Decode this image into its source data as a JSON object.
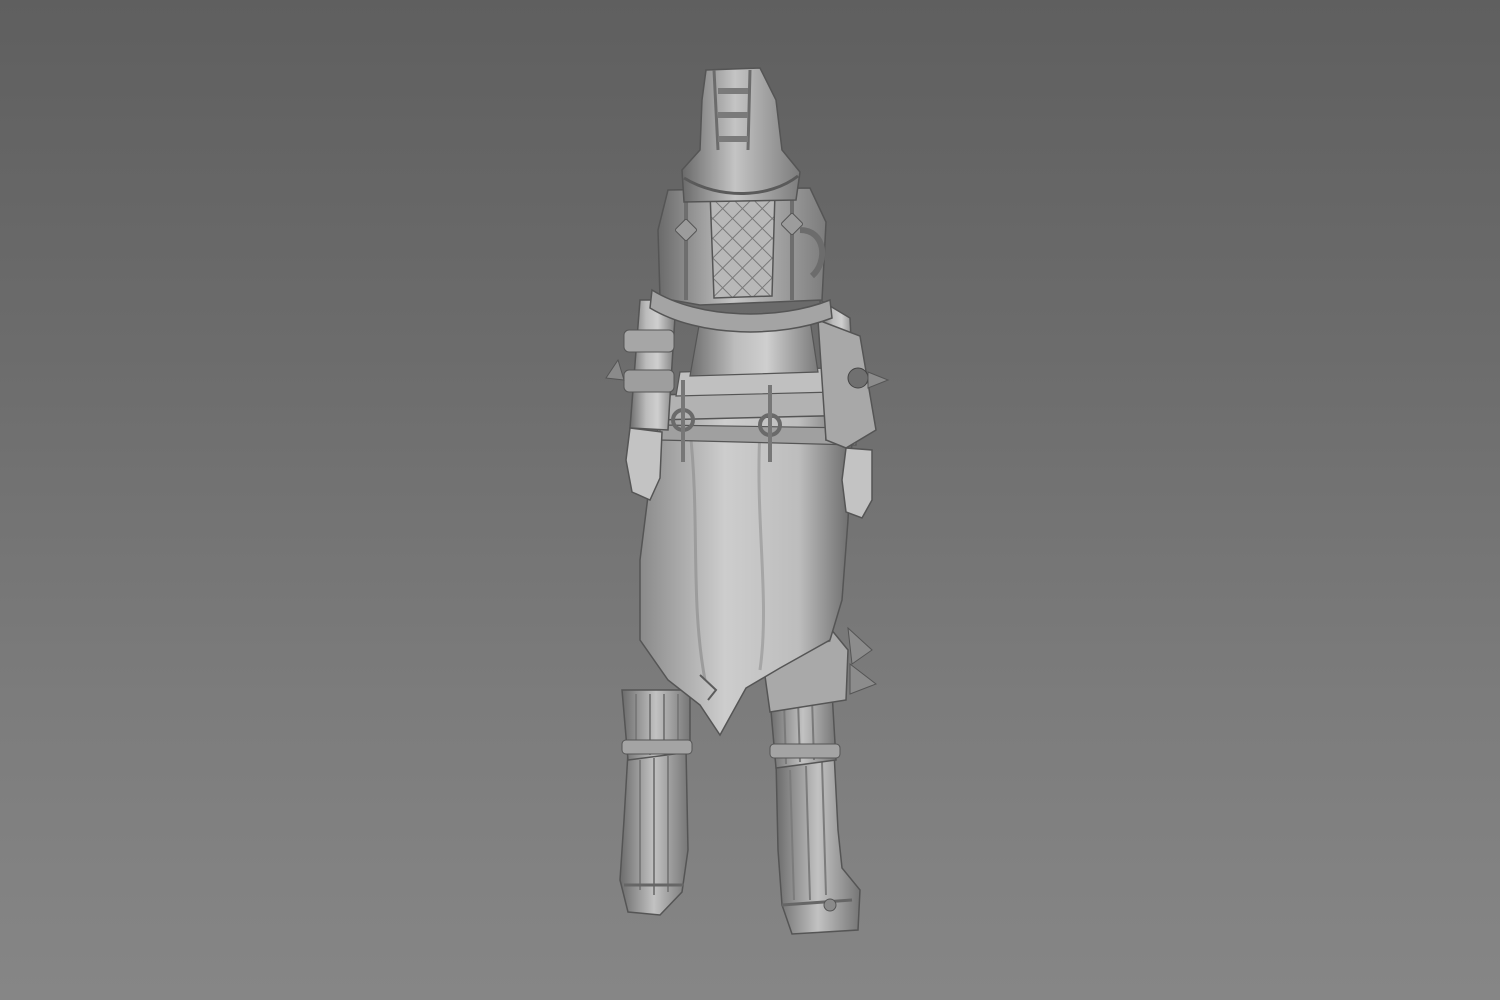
{
  "scene": {
    "subject": "sculpt-back-view",
    "background_top": "#5f5f5f",
    "background_bottom": "#868686",
    "model_light": "#c9c9c9",
    "model_mid": "#9a9a9a",
    "model_dark": "#4a4a4a"
  }
}
